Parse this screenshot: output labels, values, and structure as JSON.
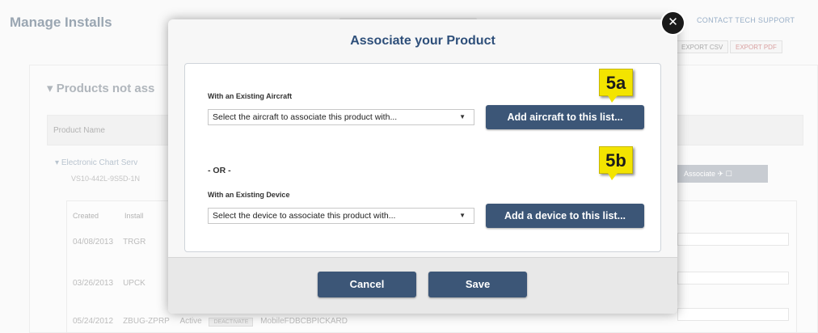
{
  "background": {
    "page_title": "Manage Installs",
    "top_link": "CONTACT TECH SUPPORT",
    "export_csv": "EXPORT CSV",
    "export_pdf": "EXPORT PDF",
    "section_title": "Products not ass",
    "column_product_name": "Product Name",
    "product_name": "Electronic Chart Serv",
    "product_serial": "VS10-442L-9S5D-1N",
    "grey_button_label": "Associate",
    "table_headers": [
      "Created",
      "Install"
    ],
    "rows": [
      {
        "date": "04/08/2013",
        "code": "TRGR"
      },
      {
        "date": "03/26/2013",
        "code": "UPCK"
      },
      {
        "date": "05/24/2012",
        "code": "ZBUG-ZPRP",
        "status": "Active",
        "tag": "DEACTIVATE",
        "device": "MobileFDBCBPICKARD"
      }
    ]
  },
  "modal": {
    "title": "Associate your Product",
    "close_glyph": "✕",
    "aircraft_label": "With an Existing Aircraft",
    "aircraft_select": "Select the aircraft to associate this product with...",
    "add_aircraft_button": "Add aircraft to this list...",
    "or_text": "- OR -",
    "device_label": "With an Existing Device",
    "device_select": "Select the device to associate this product with...",
    "add_device_button": "Add a device to this list...",
    "badge_a": "5a",
    "badge_b": "5b",
    "cancel_button": "Cancel",
    "save_button": "Save",
    "select_arrow": "▼"
  }
}
